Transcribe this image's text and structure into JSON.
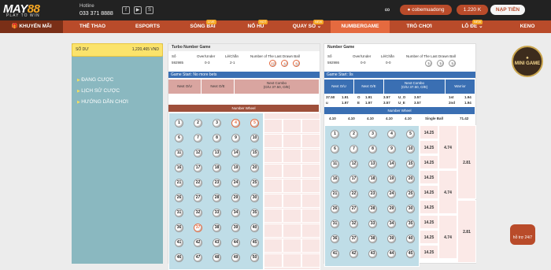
{
  "header": {
    "logo": "MAY88",
    "tagline": "PLAY TO WIN",
    "hotline_label": "Hotline",
    "hotline": "033 371 8888",
    "username": "cobemuadong",
    "balance": "1.220 K",
    "deposit": "NẠP TIỀN"
  },
  "nav": {
    "promo": "KHUYẾN MÃI",
    "items": [
      "THỂ THAO",
      "ESPORTS",
      "SÒNG BÀI",
      "NỔ HŨ",
      "QUAY SỐ ⌄",
      "NUMBERGAME",
      "TRÒ CHƠI",
      "LÔ ĐỀ ⌄",
      "KENO"
    ],
    "badges": [
      "LIVE",
      "HOT",
      "NEW",
      "NEW"
    ]
  },
  "left": {
    "balance_label": "SỐ DƯ",
    "balance_value": "1,220,465 VND",
    "menu": [
      "ĐANG CƯỢC",
      "LỊCH SỬ CƯỢC",
      "HƯỚNG DẪN CHƠI"
    ]
  },
  "turbo": {
    "title": "Turbo Number Game",
    "so_label": "Số",
    "so": "592985",
    "ou_label": "Over/Under",
    "ou": "0-3",
    "lc_label": "Lẻ/Chẵn",
    "lc": "2-1",
    "last_label": "Number of The Last Drawn Ball",
    "last": [
      "37",
      "4",
      "5"
    ],
    "status": "Game Start: No more bets",
    "nextou": "Next O/U",
    "nextoe": "Next O/E",
    "combo": "Next Combo",
    "combo2": "(O/U 37.50, O/E)",
    "wheel": "Number Wheel"
  },
  "ng": {
    "title": "Number Game",
    "so": "592986",
    "ou": "0-0",
    "lc": "0-0",
    "last": [
      "?",
      "?",
      "?"
    ],
    "status": "Game Start: 9s",
    "warrior": "Warrior",
    "odds": [
      [
        "37.50",
        "1.91",
        "O",
        "1.91",
        "3.57",
        "U_O",
        "3.57",
        "1st",
        "1.94"
      ],
      [
        "u",
        "1.97",
        "E",
        "1.97",
        "3.57",
        "U_E",
        "3.57",
        "2nd",
        "1.94"
      ]
    ],
    "wheel_odds": [
      "4.10",
      "4.10",
      "4.10",
      "4.10",
      "4.10"
    ],
    "single": "Single Ball",
    "single_val": "71.42",
    "side": [
      "14.25",
      "4.74",
      "2.81"
    ]
  },
  "mini": {
    "label": "MINI GAME"
  },
  "support": {
    "label": "hỗ trợ 24/7"
  }
}
